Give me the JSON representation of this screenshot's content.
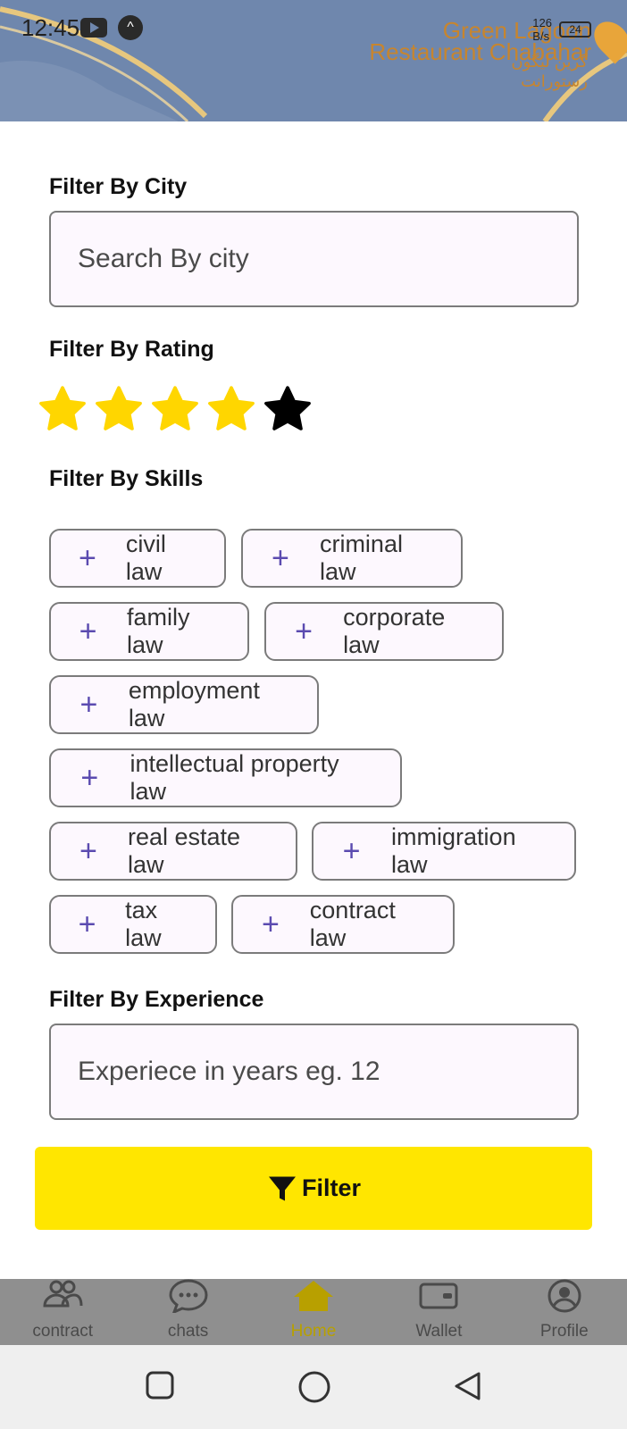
{
  "status_bar": {
    "time": "12:45",
    "network_speed": "126",
    "network_unit": "B/s",
    "battery": "24"
  },
  "map": {
    "place_name_line1": "Green Lagoon",
    "place_name_line2": "Restaurant Chabahar",
    "place_name_local_line1": "گرین لیگون",
    "place_name_local_line2": "رستورانت"
  },
  "filters": {
    "city_label": "Filter By City",
    "city_placeholder": "Search By city",
    "rating_label": "Filter By Rating",
    "rating_value": 4,
    "rating_max": 5,
    "skills_label": "Filter By Skills",
    "skills": [
      "civil law",
      "criminal law",
      "family law",
      "corporate law",
      "employment law",
      "intellectual property law",
      "real estate law",
      "immigration law",
      "tax law",
      "contract law"
    ],
    "experience_label": "Filter By Experience",
    "experience_placeholder": "Experiece in years eg. 12",
    "filter_button_label": "Filter"
  },
  "bottom_nav": {
    "items": [
      {
        "label": "contract",
        "icon": "people-icon"
      },
      {
        "label": "chats",
        "icon": "chat-icon"
      },
      {
        "label": "Home",
        "icon": "home-icon"
      },
      {
        "label": "Wallet",
        "icon": "wallet-icon"
      },
      {
        "label": "Profile",
        "icon": "profile-icon"
      }
    ],
    "active": "Home"
  },
  "colors": {
    "accent_yellow": "#ffe600",
    "star_filled": "#ffd600",
    "star_empty": "#000000",
    "plus_purple": "#5b4bb0"
  }
}
